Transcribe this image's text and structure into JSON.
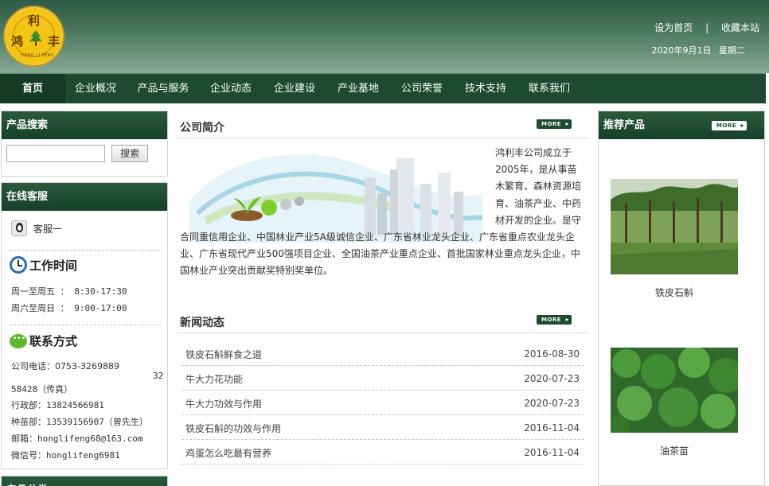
{
  "header": {
    "logo": {
      "chars": [
        "利",
        "鸿",
        "丰"
      ],
      "sub": "HONG LI FENG"
    },
    "links": [
      "设为首页",
      "收藏本站"
    ],
    "separator": "|",
    "date": "2020年9月1日",
    "weekday": "星期二"
  },
  "nav": [
    "首页",
    "企业概况",
    "产品与服务",
    "企业动态",
    "企业建设",
    "产业基地",
    "公司荣誉",
    "技术支持",
    "联系我们"
  ],
  "more_label": "MORE",
  "left": {
    "search": {
      "title": "产品搜索",
      "button": "搜索",
      "value": ""
    },
    "service": {
      "title": "在线客服",
      "qq_label": "客服一",
      "hours_title": "工作时间",
      "hours": [
        "周一至周五 ： 8:30-17:30",
        "周六至周日 ： 9:00-17:00"
      ],
      "contact_title": "联系方式",
      "phone_label": "公司电话：",
      "phone_value": "0753-3269889",
      "phone_overflow": "32",
      "fax": "58428（传真）",
      "admin": "行政部：13824566981",
      "seed": "种苗部：13539156907（曾先生）",
      "email": "邮箱：honglifeng68@163.com",
      "wechat": "微信号：honglifeng6981"
    },
    "bottom_title": "产品分类"
  },
  "center": {
    "intro_title": "公司简介",
    "intro_text": "鸿利丰公司成立于2005年，是从事苗木繁育、森林资源培育、油茶产业、中药材开发的企业。是守合同重信用企业、中国林业产业5A级诚信企业、广东省林业龙头企业、广东省重点农业龙头企业、广东省现代产业500强项目企业、全国油茶产业重点企业、首批国家林业重点龙头企业，中国林业产业突出贡献奖特别奖单位。",
    "news_title": "新闻动态",
    "news": [
      {
        "title": "铁皮石斛鲜食之道",
        "date": "2016-08-30"
      },
      {
        "title": "牛大力花功能",
        "date": "2020-07-23"
      },
      {
        "title": "牛大力功效与作用",
        "date": "2020-07-23"
      },
      {
        "title": "铁皮石斛的功效与作用",
        "date": "2016-11-04"
      },
      {
        "title": "鸡蛋怎么吃最有营养",
        "date": "2016-11-04"
      }
    ]
  },
  "right": {
    "title": "推荐产品",
    "products": [
      {
        "name": "铁皮石斛"
      },
      {
        "name": "油茶苗"
      }
    ]
  },
  "colors": {
    "brand_green": "#1d4a30",
    "header_top": "#2f5a45",
    "logo_gold": "#f4c415"
  }
}
